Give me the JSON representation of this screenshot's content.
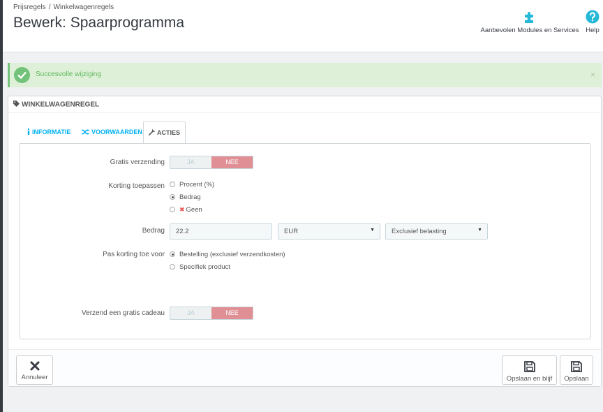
{
  "breadcrumb": [
    "Prijsregels",
    "Winkelwagenregels"
  ],
  "breadcrumb_sep": "/",
  "page_title": "Bewerk: Spaarprogramma",
  "toolbar": {
    "modules_label": "Aanbevolen Modules en Services",
    "help_label": "Help",
    "accent": "#25b9d7"
  },
  "alert": {
    "text": "Succesvolle wijziging",
    "close": "×",
    "color": "#72c279"
  },
  "panel": {
    "heading": "Winkelwagenregel",
    "tabs": [
      {
        "label": "Informatie",
        "icon": "info-icon"
      },
      {
        "label": "Voorwaarden",
        "icon": "shuffle-icon"
      },
      {
        "label": "Acties",
        "icon": "wrench-icon",
        "active": true
      }
    ]
  },
  "form": {
    "free_shipping": {
      "label": "Gratis verzending",
      "yes": "JA",
      "no": "NEE",
      "value": "NEE"
    },
    "apply_discount": {
      "label": "Korting toepassen",
      "options": [
        "Procent (%)",
        "Bedrag",
        "Geen"
      ],
      "selected": "Bedrag"
    },
    "amount": {
      "label": "Bedrag",
      "value": "22.2",
      "currency": "EUR",
      "tax": "Exclusief belasting"
    },
    "apply_to": {
      "label": "Pas korting toe voor",
      "options": [
        "Bestelling (exclusief verzendkosten)",
        "Specifiek product"
      ],
      "selected": "Bestelling (exclusief verzendkosten)"
    },
    "free_gift": {
      "label": "Verzend een gratis cadeau",
      "yes": "JA",
      "no": "NEE",
      "value": "NEE"
    }
  },
  "footer": {
    "cancel": "Annuleer",
    "save_stay": "Opslaan en blijf",
    "save": "Opslaan"
  },
  "colors": {
    "no_active": "#e08f95",
    "tab_link": "#00aff0",
    "success_bg": "#dff0d8"
  }
}
